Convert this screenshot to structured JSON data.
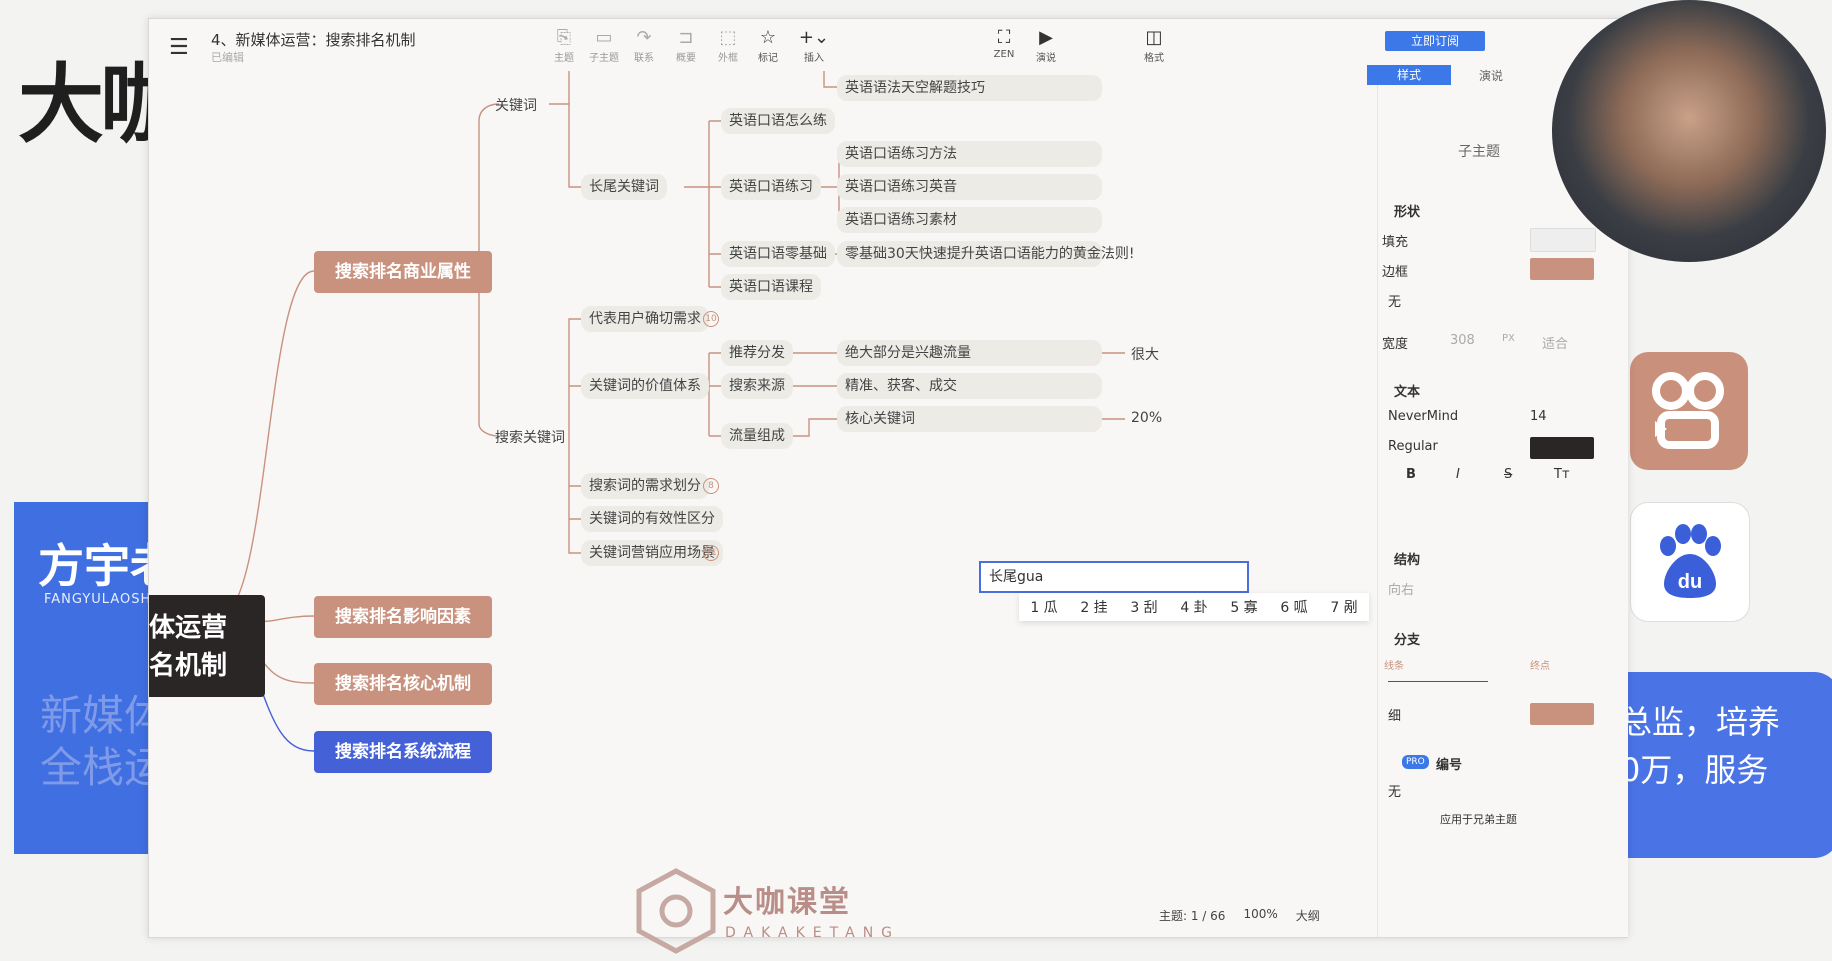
{
  "background": {
    "title_fragment": "大咖",
    "teacher_name": "方宇老",
    "teacher_pinyin": "FANGYULAOSHI",
    "faded_lines": [
      "新媒体",
      "全栈运"
    ],
    "right_text_lines": [
      "总监，培养",
      "0万，服务"
    ],
    "colors": {
      "panel_blue": "#3f6fe0",
      "accent": "#c8927e"
    }
  },
  "window": {
    "menu_icon": "hamburger-icon",
    "doc_title": "4、新媒体运营：搜索排名机制",
    "doc_subtitle": "已编辑",
    "toolbar": [
      {
        "icon": "topic-icon",
        "label": "主题"
      },
      {
        "icon": "subtopic-icon",
        "label": "子主题"
      },
      {
        "icon": "relation-icon",
        "label": "联系"
      },
      {
        "icon": "summary-icon",
        "label": "概要"
      },
      {
        "icon": "boundary-icon",
        "label": "外框"
      },
      {
        "icon": "star-icon",
        "label": "标记"
      },
      {
        "icon": "plus-icon",
        "label": "插入"
      },
      {
        "icon": "zen-icon",
        "label": "ZEN"
      },
      {
        "icon": "play-icon",
        "label": "演说"
      },
      {
        "icon": "format-icon",
        "label": "格式"
      }
    ],
    "subscribe_button": "立即订阅"
  },
  "mindmap": {
    "root_lines": [
      "体运营",
      "名机制"
    ],
    "main_branches": [
      "搜索排名商业属性",
      "搜索排名影响因素",
      "搜索排名核心机制",
      "搜索排名系统流程"
    ],
    "level2": [
      "关键词",
      "搜索关键词"
    ],
    "level3": [
      "长尾关键词",
      "代表用户确切需求",
      "关键词的价值体系",
      "搜索词的需求划分",
      "关键词的有效性区分",
      "关键词营销应用场景"
    ],
    "badges": [
      "10",
      "8",
      "11"
    ],
    "level4": [
      "英语口语怎么练",
      "英语口语练习",
      "英语口语零基础",
      "英语口语课程",
      "推荐分发",
      "搜索来源",
      "流量组成"
    ],
    "level5": [
      "英语语法天空解题技巧",
      "英语口语练习方法",
      "英语口语练习英音",
      "英语口语练习素材",
      "零基础30天快速提升英语口语能力的黄金法则!",
      "绝大部分是兴趣流量",
      "精准、获客、成交",
      "核心关键词"
    ],
    "level6": [
      "很大",
      "20%"
    ],
    "editing_text": "长尾gua",
    "ime_candidates": [
      "1 瓜",
      "2 挂",
      "3 刮",
      "4 卦",
      "5 寡",
      "6 呱",
      "7 剐"
    ]
  },
  "watermark": {
    "brand": "大咖课堂",
    "pinyin": "DAKAKETANG"
  },
  "status_bar": {
    "topic_count": "主题: 1 / 66",
    "zoom": "100%",
    "outline": "大纲"
  },
  "right_panel": {
    "tabs": [
      "样式",
      "演说"
    ],
    "subtopic_label": "子主题",
    "shape_section": "形状",
    "fill_label": "填充",
    "border_label": "边框",
    "border_value": "无",
    "width_label": "宽度",
    "width_value": "308",
    "width_unit": "PX",
    "width_fit": "适合",
    "text_section": "文本",
    "font_family": "NeverMind",
    "font_size": "14",
    "font_weight": "Regular",
    "bold": "B",
    "italic": "I",
    "strike": "S",
    "case": "Tт",
    "structure_section": "结构",
    "structure_value": "向右",
    "branch_section": "分支",
    "line_label": "线条",
    "end_label": "终点",
    "thickness": "细",
    "numbering_section": "编号",
    "numbering_pro": "PRO",
    "numbering_value": "无",
    "apply_label": "应用于兄弟主题",
    "colors": {
      "fill_swatch": "#eeeeee",
      "border_swatch": "#c8927e",
      "text_swatch": "#2a2625",
      "branch_swatch": "#c8927e"
    }
  }
}
